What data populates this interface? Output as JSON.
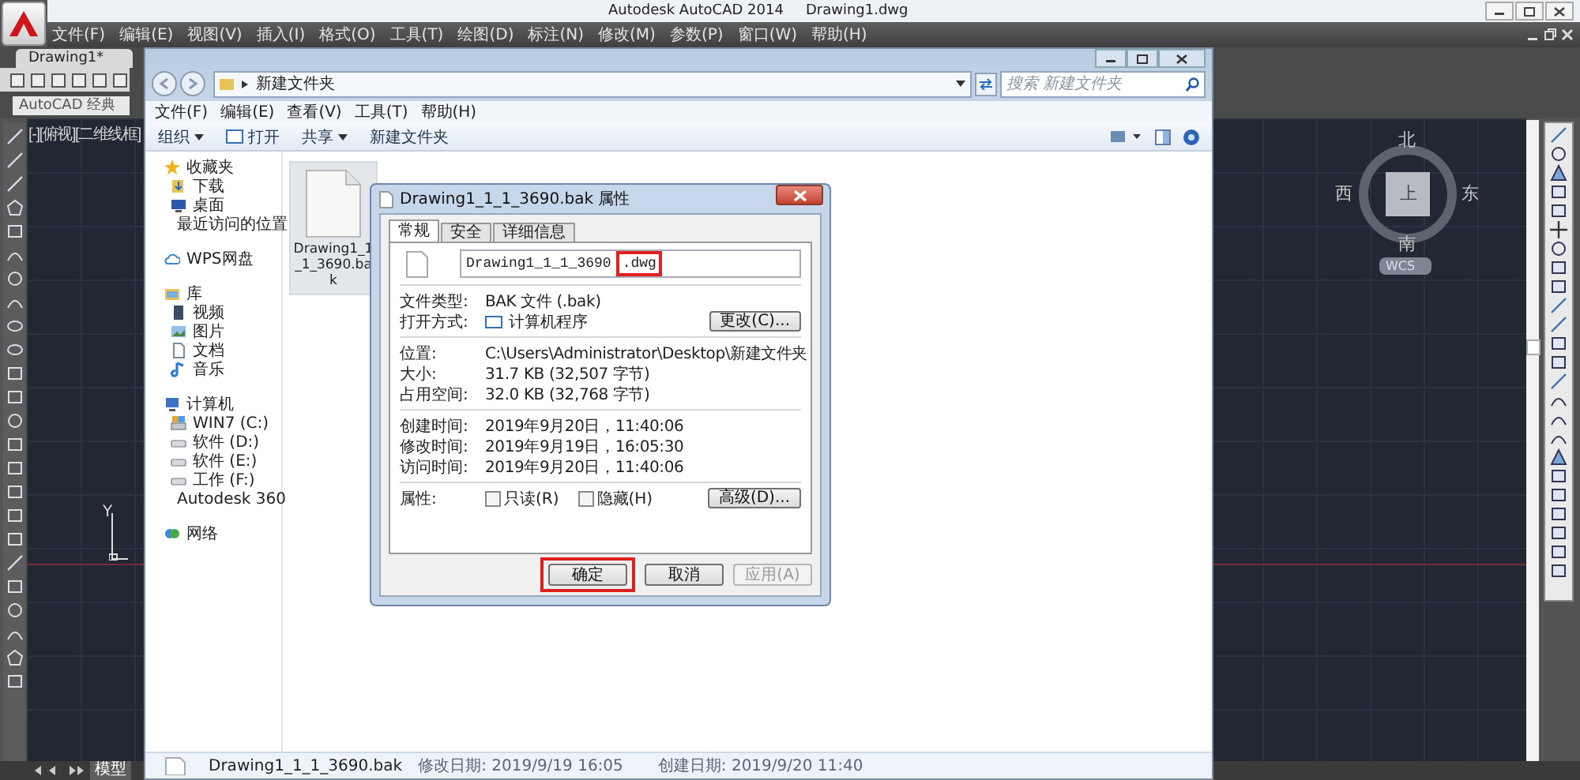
{
  "autocad": {
    "title": "Autodesk AutoCAD 2014",
    "document": "Drawing1.dwg",
    "menu": [
      "文件(F)",
      "编辑(E)",
      "视图(V)",
      "插入(I)",
      "格式(O)",
      "工具(T)",
      "绘图(D)",
      "标注(N)",
      "修改(M)",
      "参数(P)",
      "窗口(W)",
      "帮助(H)"
    ],
    "doc_tab": "Drawing1*",
    "workspace": "AutoCAD 经典",
    "viewport_label": "[-][俯视][二维线框]",
    "compass": {
      "north": "北",
      "south": "南",
      "west": "西",
      "east": "东",
      "center": "上"
    },
    "ucs": "WCS",
    "axis_label": "Y",
    "layout_tabs": [
      {
        "label": "模型",
        "selected": true
      }
    ]
  },
  "explorer": {
    "path": "新建文件夹",
    "search": {
      "placeholder": "搜索 新建文件夹"
    },
    "menu": [
      "文件(F)",
      "编辑(E)",
      "查看(V)",
      "工具(T)",
      "帮助(H)"
    ],
    "toolbar": [
      {
        "label": "组织",
        "kind": "dropdown"
      },
      {
        "label": "打开",
        "kind": "open"
      },
      {
        "label": "共享",
        "kind": "dropdown"
      },
      {
        "label": "新建文件夹",
        "kind": "plain"
      }
    ],
    "sidebar": [
      {
        "label": "收藏夹",
        "kind": "star",
        "children": [
          {
            "label": "下载",
            "kind": "download"
          },
          {
            "label": "桌面",
            "kind": "desktop"
          },
          {
            "label": "最近访问的位置",
            "kind": "recent"
          }
        ]
      },
      {
        "label": "WPS网盘",
        "kind": "cloud"
      },
      {
        "label": "库",
        "kind": "library",
        "children": [
          {
            "label": "视频",
            "kind": "video"
          },
          {
            "label": "图片",
            "kind": "picture"
          },
          {
            "label": "文档",
            "kind": "document"
          },
          {
            "label": "音乐",
            "kind": "music"
          }
        ]
      },
      {
        "label": "计算机",
        "kind": "computer",
        "children": [
          {
            "label": "WIN7 (C:)",
            "kind": "system"
          },
          {
            "label": "软件 (D:)",
            "kind": "drive"
          },
          {
            "label": "软件 (E:)",
            "kind": "drive"
          },
          {
            "label": "工作 (F:)",
            "kind": "drive"
          },
          {
            "label": "Autodesk 360",
            "kind": "cloud"
          }
        ]
      },
      {
        "label": "网络",
        "kind": "network"
      }
    ],
    "files": [
      {
        "name": "Drawing1_1_1_3690.bak",
        "selected": true
      }
    ],
    "status": {
      "name": "Drawing1_1_1_3690.bak",
      "modified": "修改日期: 2019/9/19 16:05",
      "created": "创建日期: 2019/9/20 11:40"
    }
  },
  "dialog": {
    "title": "Drawing1_1_1_3690.bak 属性",
    "tabs": [
      {
        "label": "常规",
        "selected": true
      },
      {
        "label": "安全",
        "selected": false
      },
      {
        "label": "详细信息",
        "selected": false
      }
    ],
    "filename": {
      "name": "Drawing1_1_1_3690",
      "extension": ".dwg",
      "extension_marked": true
    },
    "type_rows": [
      {
        "label": "文件类型:",
        "value": "BAK 文件 (.bak)"
      }
    ],
    "opens_with": {
      "label": "打开方式:",
      "value": "计算机程序",
      "button": "更改(C)..."
    },
    "location_rows": [
      {
        "label": "位置:",
        "value": "C:\\Users\\Administrator\\Desktop\\新建文件夹"
      },
      {
        "label": "大小:",
        "value": "31.7 KB (32,507 字节)"
      },
      {
        "label": "占用空间:",
        "value": "32.0 KB (32,768 字节)"
      }
    ],
    "time_rows": [
      {
        "label": "创建时间:",
        "value": "2019年9月20日，11:40:06"
      },
      {
        "label": "修改时间:",
        "value": "2019年9月19日，16:05:30"
      },
      {
        "label": "访问时间:",
        "value": "2019年9月20日，11:40:06"
      }
    ],
    "attributes": {
      "label": "属性:",
      "options": [
        {
          "label": "只读(R)",
          "checked": false
        },
        {
          "label": "隐藏(H)",
          "checked": false
        }
      ],
      "button": "高级(D)..."
    },
    "buttons": [
      {
        "label": "确定",
        "marked": true,
        "disabled": false
      },
      {
        "label": "取消",
        "marked": false,
        "disabled": false
      },
      {
        "label": "应用(A)",
        "marked": false,
        "disabled": true
      }
    ]
  }
}
